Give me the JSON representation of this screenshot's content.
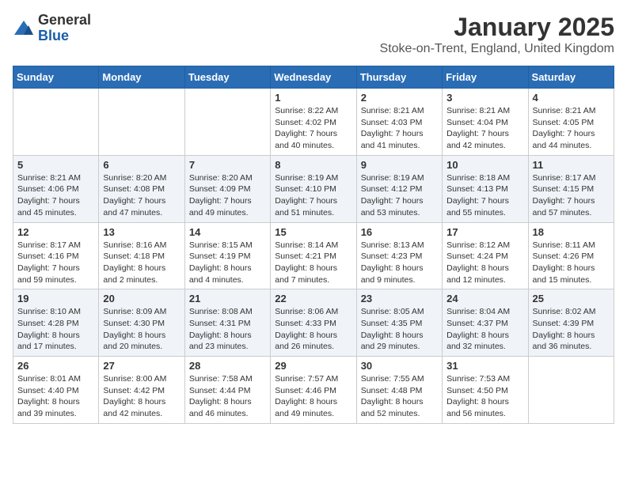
{
  "logo": {
    "general": "General",
    "blue": "Blue"
  },
  "title": {
    "month": "January 2025",
    "location": "Stoke-on-Trent, England, United Kingdom"
  },
  "weekdays": [
    "Sunday",
    "Monday",
    "Tuesday",
    "Wednesday",
    "Thursday",
    "Friday",
    "Saturday"
  ],
  "weeks": [
    [
      {
        "day": "",
        "sunrise": "",
        "sunset": "",
        "daylight": ""
      },
      {
        "day": "",
        "sunrise": "",
        "sunset": "",
        "daylight": ""
      },
      {
        "day": "",
        "sunrise": "",
        "sunset": "",
        "daylight": ""
      },
      {
        "day": "1",
        "sunrise": "Sunrise: 8:22 AM",
        "sunset": "Sunset: 4:02 PM",
        "daylight": "Daylight: 7 hours and 40 minutes."
      },
      {
        "day": "2",
        "sunrise": "Sunrise: 8:21 AM",
        "sunset": "Sunset: 4:03 PM",
        "daylight": "Daylight: 7 hours and 41 minutes."
      },
      {
        "day": "3",
        "sunrise": "Sunrise: 8:21 AM",
        "sunset": "Sunset: 4:04 PM",
        "daylight": "Daylight: 7 hours and 42 minutes."
      },
      {
        "day": "4",
        "sunrise": "Sunrise: 8:21 AM",
        "sunset": "Sunset: 4:05 PM",
        "daylight": "Daylight: 7 hours and 44 minutes."
      }
    ],
    [
      {
        "day": "5",
        "sunrise": "Sunrise: 8:21 AM",
        "sunset": "Sunset: 4:06 PM",
        "daylight": "Daylight: 7 hours and 45 minutes."
      },
      {
        "day": "6",
        "sunrise": "Sunrise: 8:20 AM",
        "sunset": "Sunset: 4:08 PM",
        "daylight": "Daylight: 7 hours and 47 minutes."
      },
      {
        "day": "7",
        "sunrise": "Sunrise: 8:20 AM",
        "sunset": "Sunset: 4:09 PM",
        "daylight": "Daylight: 7 hours and 49 minutes."
      },
      {
        "day": "8",
        "sunrise": "Sunrise: 8:19 AM",
        "sunset": "Sunset: 4:10 PM",
        "daylight": "Daylight: 7 hours and 51 minutes."
      },
      {
        "day": "9",
        "sunrise": "Sunrise: 8:19 AM",
        "sunset": "Sunset: 4:12 PM",
        "daylight": "Daylight: 7 hours and 53 minutes."
      },
      {
        "day": "10",
        "sunrise": "Sunrise: 8:18 AM",
        "sunset": "Sunset: 4:13 PM",
        "daylight": "Daylight: 7 hours and 55 minutes."
      },
      {
        "day": "11",
        "sunrise": "Sunrise: 8:17 AM",
        "sunset": "Sunset: 4:15 PM",
        "daylight": "Daylight: 7 hours and 57 minutes."
      }
    ],
    [
      {
        "day": "12",
        "sunrise": "Sunrise: 8:17 AM",
        "sunset": "Sunset: 4:16 PM",
        "daylight": "Daylight: 7 hours and 59 minutes."
      },
      {
        "day": "13",
        "sunrise": "Sunrise: 8:16 AM",
        "sunset": "Sunset: 4:18 PM",
        "daylight": "Daylight: 8 hours and 2 minutes."
      },
      {
        "day": "14",
        "sunrise": "Sunrise: 8:15 AM",
        "sunset": "Sunset: 4:19 PM",
        "daylight": "Daylight: 8 hours and 4 minutes."
      },
      {
        "day": "15",
        "sunrise": "Sunrise: 8:14 AM",
        "sunset": "Sunset: 4:21 PM",
        "daylight": "Daylight: 8 hours and 7 minutes."
      },
      {
        "day": "16",
        "sunrise": "Sunrise: 8:13 AM",
        "sunset": "Sunset: 4:23 PM",
        "daylight": "Daylight: 8 hours and 9 minutes."
      },
      {
        "day": "17",
        "sunrise": "Sunrise: 8:12 AM",
        "sunset": "Sunset: 4:24 PM",
        "daylight": "Daylight: 8 hours and 12 minutes."
      },
      {
        "day": "18",
        "sunrise": "Sunrise: 8:11 AM",
        "sunset": "Sunset: 4:26 PM",
        "daylight": "Daylight: 8 hours and 15 minutes."
      }
    ],
    [
      {
        "day": "19",
        "sunrise": "Sunrise: 8:10 AM",
        "sunset": "Sunset: 4:28 PM",
        "daylight": "Daylight: 8 hours and 17 minutes."
      },
      {
        "day": "20",
        "sunrise": "Sunrise: 8:09 AM",
        "sunset": "Sunset: 4:30 PM",
        "daylight": "Daylight: 8 hours and 20 minutes."
      },
      {
        "day": "21",
        "sunrise": "Sunrise: 8:08 AM",
        "sunset": "Sunset: 4:31 PM",
        "daylight": "Daylight: 8 hours and 23 minutes."
      },
      {
        "day": "22",
        "sunrise": "Sunrise: 8:06 AM",
        "sunset": "Sunset: 4:33 PM",
        "daylight": "Daylight: 8 hours and 26 minutes."
      },
      {
        "day": "23",
        "sunrise": "Sunrise: 8:05 AM",
        "sunset": "Sunset: 4:35 PM",
        "daylight": "Daylight: 8 hours and 29 minutes."
      },
      {
        "day": "24",
        "sunrise": "Sunrise: 8:04 AM",
        "sunset": "Sunset: 4:37 PM",
        "daylight": "Daylight: 8 hours and 32 minutes."
      },
      {
        "day": "25",
        "sunrise": "Sunrise: 8:02 AM",
        "sunset": "Sunset: 4:39 PM",
        "daylight": "Daylight: 8 hours and 36 minutes."
      }
    ],
    [
      {
        "day": "26",
        "sunrise": "Sunrise: 8:01 AM",
        "sunset": "Sunset: 4:40 PM",
        "daylight": "Daylight: 8 hours and 39 minutes."
      },
      {
        "day": "27",
        "sunrise": "Sunrise: 8:00 AM",
        "sunset": "Sunset: 4:42 PM",
        "daylight": "Daylight: 8 hours and 42 minutes."
      },
      {
        "day": "28",
        "sunrise": "Sunrise: 7:58 AM",
        "sunset": "Sunset: 4:44 PM",
        "daylight": "Daylight: 8 hours and 46 minutes."
      },
      {
        "day": "29",
        "sunrise": "Sunrise: 7:57 AM",
        "sunset": "Sunset: 4:46 PM",
        "daylight": "Daylight: 8 hours and 49 minutes."
      },
      {
        "day": "30",
        "sunrise": "Sunrise: 7:55 AM",
        "sunset": "Sunset: 4:48 PM",
        "daylight": "Daylight: 8 hours and 52 minutes."
      },
      {
        "day": "31",
        "sunrise": "Sunrise: 7:53 AM",
        "sunset": "Sunset: 4:50 PM",
        "daylight": "Daylight: 8 hours and 56 minutes."
      },
      {
        "day": "",
        "sunrise": "",
        "sunset": "",
        "daylight": ""
      }
    ]
  ]
}
